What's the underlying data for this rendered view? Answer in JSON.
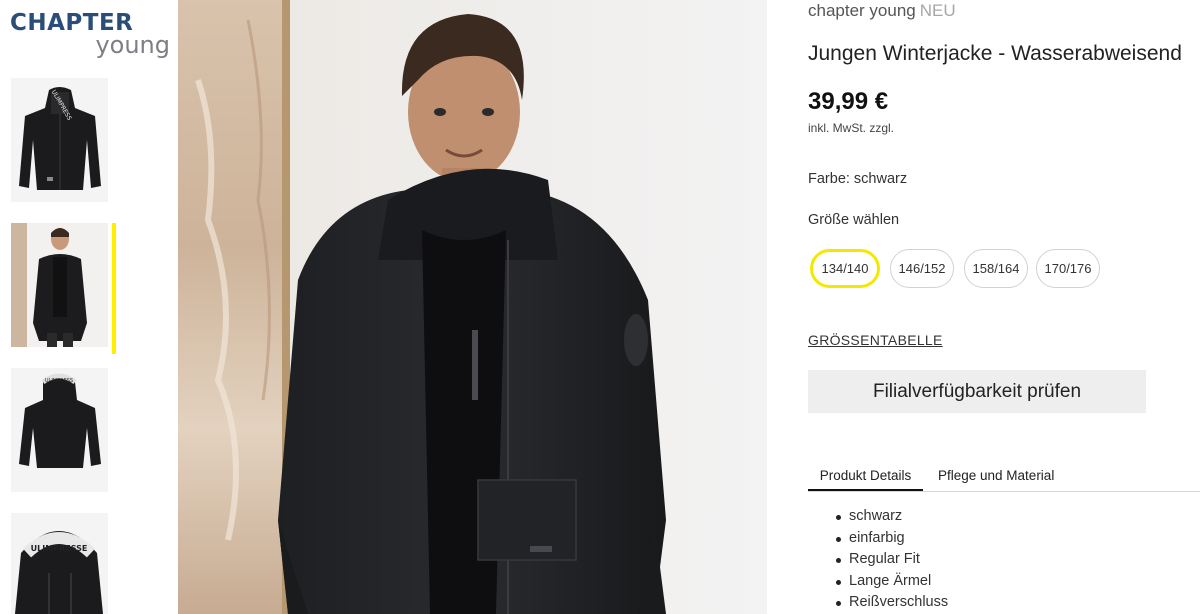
{
  "logo": {
    "line1": "CHAPTER",
    "line2": "young"
  },
  "thumbnails": [
    {
      "name": "jacket-front",
      "active": false
    },
    {
      "name": "model-front",
      "active": true
    },
    {
      "name": "jacket-back",
      "active": false
    },
    {
      "name": "hood-detail",
      "active": false
    }
  ],
  "product": {
    "brand": "chapter young",
    "badge": "NEU",
    "title": "Jungen Winterjacke - Wasserabweisend",
    "price": "39,99 €",
    "tax_note": "inkl. MwSt. zzgl.",
    "color_label": "Farbe: schwarz",
    "size_label": "Größe wählen",
    "sizes": [
      {
        "label": "134/140",
        "selected": true
      },
      {
        "label": "146/152",
        "selected": false
      },
      {
        "label": "158/164",
        "selected": false
      },
      {
        "label": "170/176",
        "selected": false
      }
    ],
    "size_table_link": "GRÖSSENTABELLE",
    "store_button": "Filialverfügbarkeit prüfen"
  },
  "tabs": [
    {
      "label": "Produkt Details",
      "active": true
    },
    {
      "label": "Pflege und Material",
      "active": false
    }
  ],
  "details": [
    "schwarz",
    "einfarbig",
    "Regular Fit",
    "Lange Ärmel",
    "Reißverschluss"
  ],
  "colors": {
    "accent_yellow": "#f5e800",
    "logo_blue": "#2b4e78",
    "logo_gray": "#7d7f85",
    "button_bg": "#eeeeee"
  }
}
